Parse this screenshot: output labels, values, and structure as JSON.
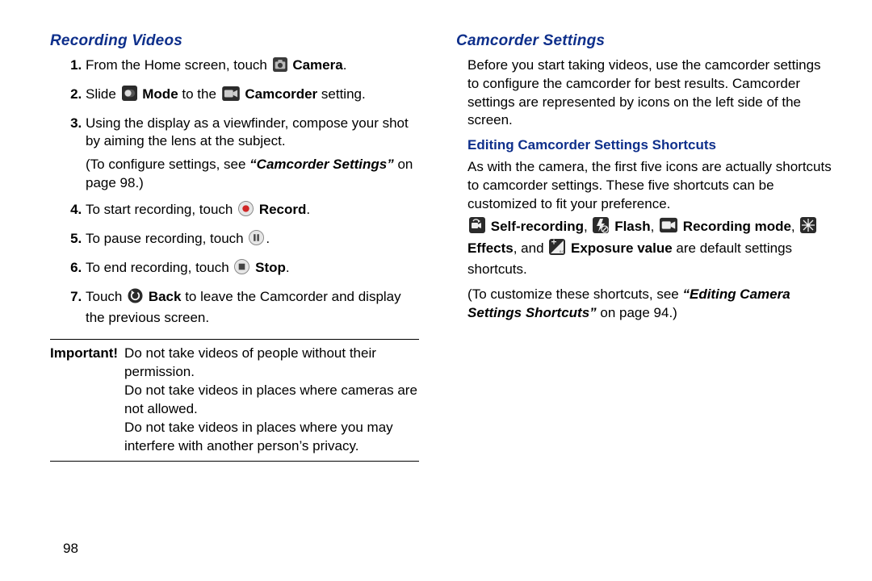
{
  "left": {
    "heading": "Recording Videos",
    "step1_a": "From the Home screen, touch ",
    "step1_b": "Camera",
    "step1_c": ".",
    "step2_a": "Slide ",
    "step2_b": "Mode",
    "step2_c": " to the ",
    "step2_d": "Camcorder",
    "step2_e": " setting.",
    "step3": "Using the display as a viewfinder, compose your shot by aiming the lens at the subject.",
    "step3_note_a": "(To configure settings, see ",
    "step3_note_b": "“Camcorder Settings”",
    "step3_note_c": " on page 98.)",
    "step4_a": "To start recording, touch ",
    "step4_b": "Record",
    "step4_c": ".",
    "step5": "To pause recording, touch ",
    "step5_end": ".",
    "step6_a": "To end recording, touch ",
    "step6_b": "Stop",
    "step6_c": ".",
    "step7_a": "Touch ",
    "step7_b": "Back",
    "step7_c": " to leave the Camcorder and display the previous screen.",
    "important_label": "Important!",
    "important_l1": "Do not take videos of people without their permission.",
    "important_l2": "Do not take videos in places where cameras are not allowed.",
    "important_l3": "Do not take videos in places where you may interfere with another person’s privacy."
  },
  "right": {
    "heading": "Camcorder Settings",
    "intro": "Before you start taking videos, use the camcorder settings to configure the camcorder for best results. Camcorder settings are represented by icons on the left side of the screen.",
    "subheading": "Editing Camcorder Settings Shortcuts",
    "p1": "As with the camera, the first five icons are actually shortcuts to camcorder settings. These five shortcuts can be customized to fit your preference.",
    "sr": "Self-recording",
    "fl": "Flash",
    "rm": "Recording mode",
    "ef": "Effects",
    "and": ", and ",
    "ev": "Exposure value",
    "tail": " are default settings shortcuts.",
    "custom_a": "(To customize these shortcuts, see ",
    "custom_b": "“Editing Camera Settings Shortcuts”",
    "custom_c": " on page 94.)"
  },
  "page_number": "98"
}
